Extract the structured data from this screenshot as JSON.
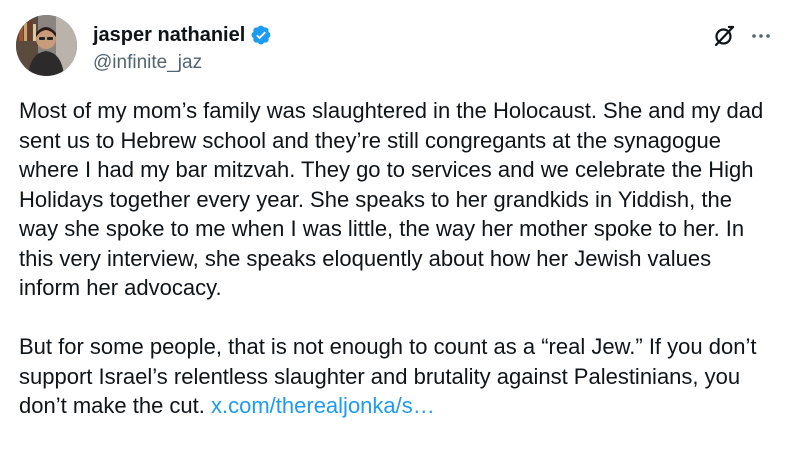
{
  "user": {
    "display_name": "jasper nathaniel",
    "handle": "@infinite_jaz",
    "verified": true
  },
  "tweet": {
    "paragraph_1": "Most of my mom’s family was slaughtered in the Holocaust. She and my dad sent us to Hebrew school and they’re still congregants at the synagogue where I had my bar mitzvah. They go to services and we celebrate the High Holidays together every year. She speaks to her grandkids in Yiddish, the way she spoke to me when I was little, the way her mother spoke to her. In this very interview, she speaks eloquently about how her Jewish values inform her advocacy.",
    "paragraph_2_text": "But for some people, that is not enough to count as a “real Jew.” If you don’t support Israel’s relentless slaughter and brutality against Palestinians, you don’t make the cut. ",
    "link_text": "x.com/therealjonka/s…"
  },
  "icons": {
    "verified": "verified-badge-icon",
    "grok": "grok-icon",
    "more": "more-icon"
  },
  "colors": {
    "text": "#0f1419",
    "secondary": "#536471",
    "link": "#1d9bf0",
    "verified": "#1d9bf0"
  }
}
